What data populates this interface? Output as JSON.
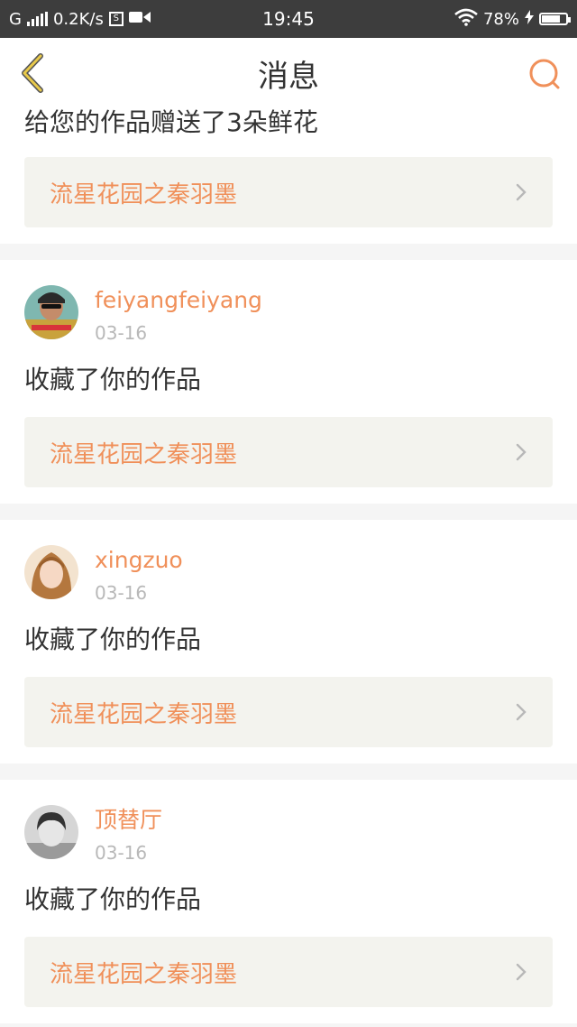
{
  "status_bar": {
    "network_type": "G",
    "speed": "0.2K/s",
    "sim_glyph": "S",
    "video_icon": "video-camera-icon",
    "time": "19:45",
    "wifi_icon": "wifi-icon",
    "battery": "78%",
    "battery_level": 0.78,
    "charging_icon": "lightning-icon"
  },
  "nav": {
    "back_icon": "chevron-left-icon",
    "title": "消息",
    "search_icon": "search-icon"
  },
  "colors": {
    "accent": "#f0905a",
    "back_arrow": "#e8c94a",
    "text": "#333333",
    "date": "#b8b8b8",
    "link_bg": "#f3f3ee",
    "statusbar": "#3d3d3d"
  },
  "messages": [
    {
      "action": "给您的作品赠送了3朵鲜花",
      "work_title": "流星花园之秦羽墨"
    },
    {
      "username": "feiyangfeiyang",
      "date": "03-16",
      "action": "收藏了你的作品",
      "work_title": "流星花园之秦羽墨"
    },
    {
      "username": "xingzuo",
      "date": "03-16",
      "action": "收藏了你的作品",
      "work_title": "流星花园之秦羽墨"
    },
    {
      "username": "顶替厅",
      "date": "03-16",
      "action": "收藏了你的作品",
      "work_title": "流星花园之秦羽墨"
    }
  ]
}
